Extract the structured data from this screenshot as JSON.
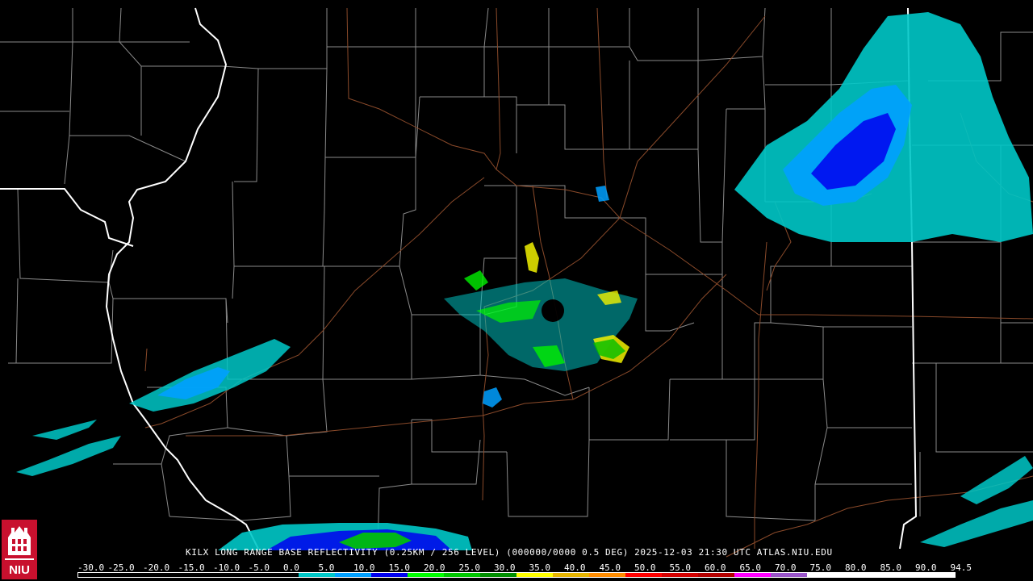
{
  "caption": "KILX LONG RANGE BASE REFLECTIVITY (0.25KM / 256 LEVEL) (000000/0000 0.5 DEG) 2025-12-03 21:30 UTC  ATLAS.NIU.EDU",
  "logo_text": "NIU",
  "scale": {
    "labels": [
      "-30.0",
      "-25.0",
      "-20.0",
      "-15.0",
      "-10.0",
      "-5.0",
      "0.0",
      "5.0",
      "10.0",
      "15.0",
      "20.0",
      "25.0",
      "30.0",
      "35.0",
      "40.0",
      "45.0",
      "50.0",
      "55.0",
      "60.0",
      "65.0",
      "70.0",
      "75.0",
      "80.0",
      "85.0",
      "90.0",
      "94.5"
    ],
    "colors": [
      "#000000",
      "#000000",
      "#000000",
      "#000000",
      "#000000",
      "#000000",
      "#00c8c8",
      "#00a0ff",
      "#0000f0",
      "#00ff00",
      "#00c800",
      "#009000",
      "#ffff00",
      "#e6b400",
      "#ff8c00",
      "#ff0000",
      "#d40000",
      "#b40000",
      "#ff00ff",
      "#9955c9",
      "#ffffff",
      "#ffffff",
      "#ffffff",
      "#ffffff",
      "#ffffff"
    ]
  },
  "colors": {
    "background": "#000000",
    "county_lines": "#8a8a8a",
    "state_lines": "#ffffff",
    "highways": "#8a4a2a",
    "logo_red": "#c8102e"
  }
}
